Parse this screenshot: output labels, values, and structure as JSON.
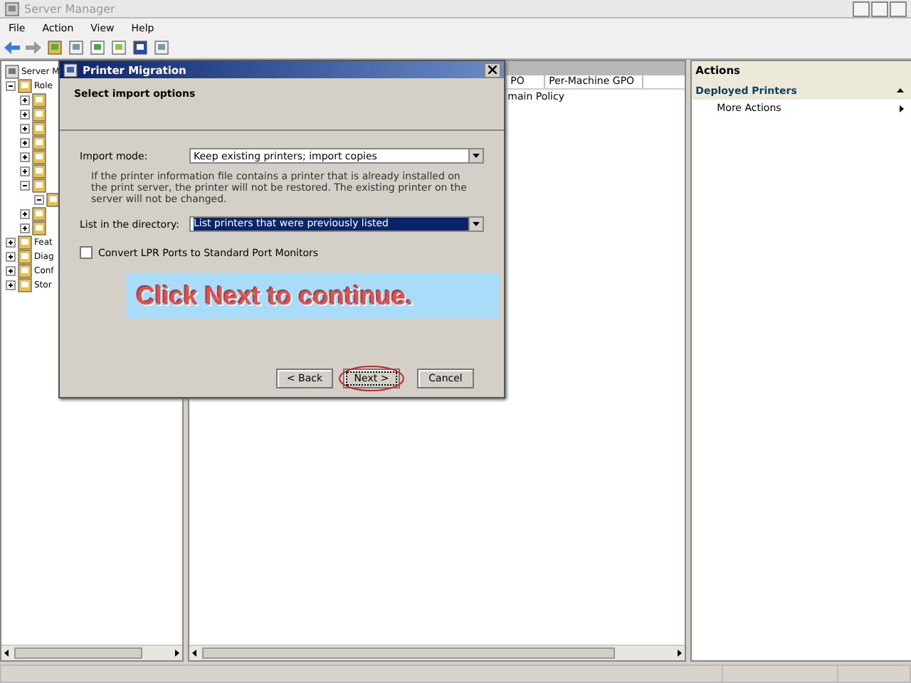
{
  "window": {
    "title": "Server Manager"
  },
  "menu": [
    "File",
    "Action",
    "View",
    "Help"
  ],
  "tree": [
    {
      "label": "Server M",
      "children": [
        {
          "label": "Role",
          "expanded": true,
          "children": [
            {
              "expanded": false
            },
            {
              "expanded": false
            },
            {
              "expanded": false
            },
            {
              "expanded": false
            },
            {
              "expanded": false
            },
            {
              "expanded": false
            },
            {
              "expanded": true,
              "children": [
                {
                  "expanded": true
                }
              ]
            },
            {
              "expanded": false
            },
            {
              "expanded": false
            }
          ]
        },
        {
          "label": "Feat",
          "expanded": false
        },
        {
          "label": "Diag",
          "expanded": false
        },
        {
          "label": "Conf",
          "expanded": false
        },
        {
          "label": "Stor",
          "expanded": false
        }
      ]
    }
  ],
  "table": {
    "columns": [
      "PO",
      "Per-Machine GPO"
    ],
    "rows": [
      [
        "main Policy",
        ""
      ]
    ]
  },
  "actions": {
    "title": "Actions",
    "section": "Deployed Printers",
    "items": [
      "More Actions"
    ]
  },
  "dialog": {
    "title": "Printer Migration",
    "heading": "Select import options",
    "import_mode": {
      "label": "Import mode:",
      "value": "Keep existing printers; import copies",
      "selected": false
    },
    "note": "If the printer information file contains a printer that is already installed on the print server, the printer will not be restored. The existing printer on the server will not be changed.",
    "list_directory": {
      "label": "List in the directory:",
      "value": "List printers that were previously listed",
      "selected": true
    },
    "convert": {
      "label": "Convert LPR Ports to Standard Port Monitors",
      "checked": false
    },
    "callout": "Click Next to continue.",
    "buttons": [
      {
        "label": "< Back",
        "highlighted": false
      },
      {
        "label": "Next >",
        "highlighted": true
      },
      {
        "label": "Cancel",
        "highlighted": false
      }
    ]
  }
}
